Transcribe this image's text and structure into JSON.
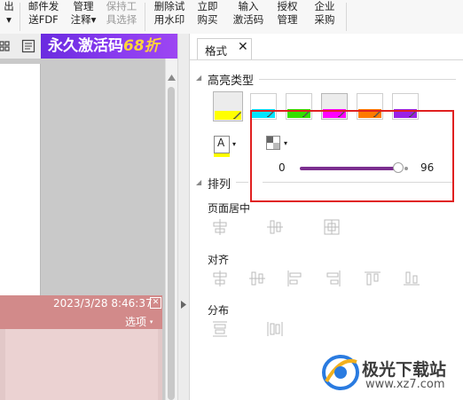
{
  "ribbon": {
    "groups": [
      {
        "line1": "出",
        "line2": "▾",
        "disabled": false
      },
      {
        "line1": "邮件发",
        "line2": "送FDF",
        "disabled": false
      },
      {
        "line1": "管理",
        "line2": "注释▾",
        "disabled": false
      },
      {
        "line1": "保持工",
        "line2": "具选择",
        "disabled": true
      },
      {
        "line1": "删除试",
        "line2": "用水印",
        "disabled": false
      },
      {
        "line1": "立即",
        "line2": "购买",
        "disabled": false
      },
      {
        "line1": "输入",
        "line2": "激活码",
        "disabled": false
      },
      {
        "line1": "授权",
        "line2": "管理",
        "disabled": false
      },
      {
        "line1": "企业",
        "line2": "采购",
        "disabled": false
      }
    ]
  },
  "banner": {
    "text": "永久激活码",
    "number": "68折"
  },
  "comment": {
    "timestamp": "2023/3/28 8:46:37",
    "options_label": "选项"
  },
  "panel": {
    "tab_label": "格式",
    "highlight_section": "高亮类型",
    "swatch_colors": [
      "#ffff00",
      "#00e5ff",
      "#33e000",
      "#ff00ff",
      "#ff7a00",
      "#9a22e6"
    ],
    "font_color_letter": "A",
    "font_color": "#ffff00",
    "opacity_min": "0",
    "opacity_value": "96",
    "opacity_fraction": 0.96,
    "arrange_section": "排列",
    "page_center_label": "页面居中",
    "align_label": "对齐",
    "distribute_label": "分布"
  },
  "watermark": {
    "brand": "极光下载站",
    "url": "www.xz7.com"
  },
  "colors": {
    "highlight_border": "#e02020",
    "slider": "#7b2f8f",
    "banner": "#7a33e8"
  }
}
